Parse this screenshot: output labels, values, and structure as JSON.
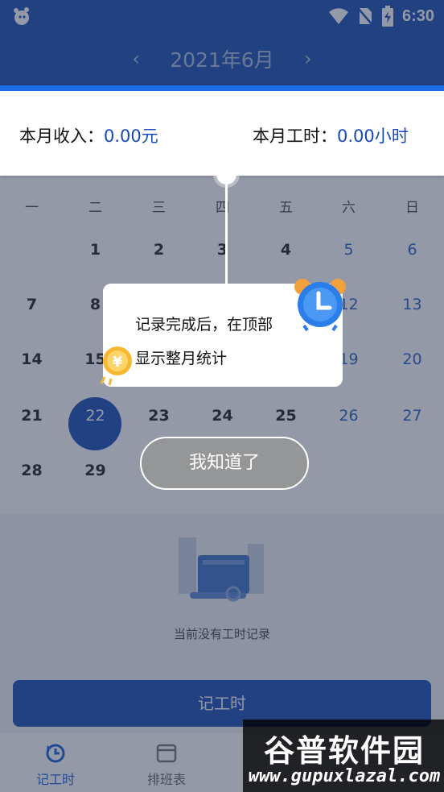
{
  "status_bar": {
    "time": "6:30"
  },
  "header": {
    "prev_icon": "chevron-left-icon",
    "next_icon": "chevron-right-icon",
    "prev": "‹",
    "next": "›",
    "month": "2021年6月"
  },
  "summary": {
    "income_label": "本月收入：",
    "income_value": "0.00元",
    "hours_label": "本月工时：",
    "hours_value": "0.00小时"
  },
  "calendar": {
    "weekdays": [
      "一",
      "二",
      "三",
      "四",
      "五",
      "六",
      "日"
    ],
    "rows": [
      [
        "",
        "1",
        "2",
        "3",
        "4",
        "5",
        "6"
      ],
      [
        "7",
        "8",
        "",
        "",
        "",
        "12",
        "13"
      ],
      [
        "14",
        "15",
        "",
        "",
        "",
        "19",
        "20"
      ],
      [
        "21",
        "22",
        "23",
        "24",
        "25",
        "26",
        "27"
      ],
      [
        "28",
        "29",
        "",
        "",
        "",
        "",
        ""
      ]
    ],
    "today": "22"
  },
  "empty_state": {
    "text": "当前没有工时记录"
  },
  "primary_button": {
    "label": "记工时"
  },
  "tabs": [
    {
      "label": "记工时",
      "active": true,
      "icon": "clock-refresh-icon"
    },
    {
      "label": "排班表",
      "active": false,
      "icon": "calendar-icon"
    }
  ],
  "guide": {
    "line1": "记录完成后，在顶部",
    "line2": "显示整月统计",
    "dismiss": "我知道了"
  },
  "watermark": {
    "title": "谷普软件园",
    "url": "www.gupuxlazal.com"
  },
  "colors": {
    "primary": "#1a4fb3",
    "accent": "#1c6ee8",
    "value_text": "#1748b8",
    "weekend": "#2a5fbf"
  }
}
